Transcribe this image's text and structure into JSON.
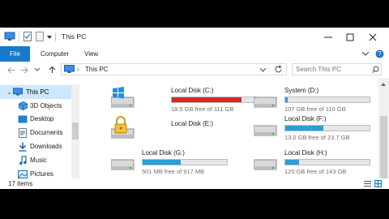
{
  "window": {
    "title": "This PC"
  },
  "ribbon": {
    "file_label": "File",
    "tabs": [
      "Computer",
      "View"
    ]
  },
  "address": {
    "path": "This PC"
  },
  "search": {
    "placeholder": "Search This PC"
  },
  "sidebar": {
    "items": [
      {
        "label": "This PC",
        "icon": "monitor-icon",
        "selected": true
      },
      {
        "label": "3D Objects",
        "icon": "cube-icon"
      },
      {
        "label": "Desktop",
        "icon": "desktop-icon"
      },
      {
        "label": "Documents",
        "icon": "documents-icon"
      },
      {
        "label": "Downloads",
        "icon": "downloads-icon"
      },
      {
        "label": "Music",
        "icon": "music-icon"
      },
      {
        "label": "Pictures",
        "icon": "pictures-icon"
      }
    ]
  },
  "drives": [
    {
      "name": "Local Disk (C:)",
      "free": "18.5 GB free of 111 GB",
      "used_fraction": 0.83,
      "bar_color": "#da2626",
      "icon": "windows-drive-icon"
    },
    {
      "name": "System (D:)",
      "free": "107 GB free of 110 GB",
      "used_fraction": 0.03,
      "bar_color": "#26a0da",
      "icon": "hard-drive-icon"
    },
    {
      "name": "Local Disk (E:)",
      "icon": "locked-drive-icon"
    },
    {
      "name": "Local Disk (F:)",
      "free": "13.0 GB free of 23.7 GB",
      "used_fraction": 0.45,
      "bar_color": "#26a0da",
      "icon": "hard-drive-icon"
    },
    {
      "name": "Local Disk (G:)",
      "free": "501 MB free of 917 MB",
      "used_fraction": 0.45,
      "bar_color": "#26a0da",
      "icon": "hard-drive-icon"
    },
    {
      "name": "Local Disk (H:)",
      "free": "120 GB free of 143 GB",
      "used_fraction": 0.16,
      "bar_color": "#26a0da",
      "icon": "hard-drive-icon"
    }
  ],
  "status": {
    "items": "17 items"
  },
  "colors": {
    "accent": "#1979ca",
    "selection": "#cce8ff",
    "bar_normal": "#26a0da",
    "bar_full": "#da2626"
  }
}
